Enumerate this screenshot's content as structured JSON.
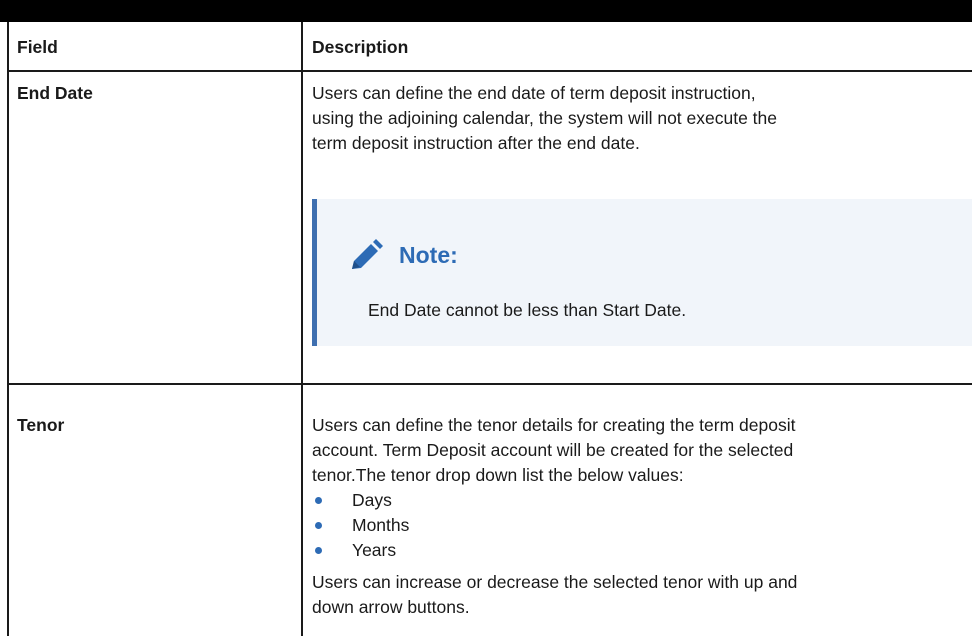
{
  "table": {
    "headers": {
      "field": "Field",
      "description": "Description"
    },
    "rows": [
      {
        "field": "End Date",
        "description_lines": [
          "Users can define the end date of term deposit instruction,",
          "using the adjoining calendar, the system will not execute the",
          "term deposit instruction after the end date."
        ],
        "note": {
          "title": "Note:",
          "body": "End Date cannot be less than Start Date.",
          "icon": "pencil-icon"
        }
      },
      {
        "field": "Tenor",
        "description_lines": [
          "Users can define the tenor details for creating the term deposit",
          "account. Term Deposit account will be created for the selected",
          "tenor.The tenor drop down list the below values:"
        ],
        "list_items": [
          "Days",
          "Months",
          "Years"
        ],
        "after_lines": [
          "Users can increase or decrease the selected tenor with up and",
          "down arrow buttons."
        ]
      }
    ]
  },
  "colors": {
    "note_accent": "#3e6fb0",
    "note_title": "#2d6bb5",
    "bullet": "#2d6bb5",
    "note_bg": "#f1f5fa"
  }
}
